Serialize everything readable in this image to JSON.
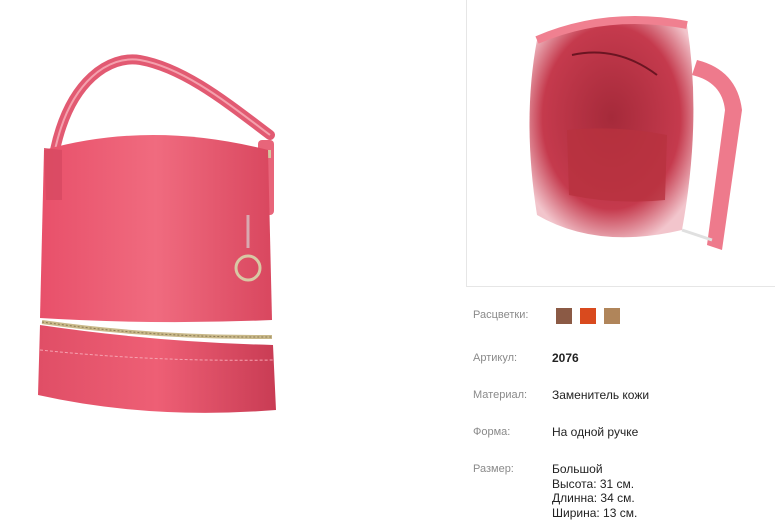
{
  "details": {
    "colors_label": "Расцветки:",
    "colors": [
      "#8b5a45",
      "#d94a1e",
      "#b0855a"
    ],
    "article_label": "Артикул:",
    "article_value": "2076",
    "material_label": "Материал:",
    "material_value": "Заменитель кожи",
    "shape_label": "Форма:",
    "shape_value": "На одной ручке",
    "size_label": "Размер:",
    "size_lines": [
      "Большой",
      "Высота: 31 см.",
      "Длинна: 34 см.",
      "Ширина: 13 см."
    ]
  },
  "images": {
    "main_icon": "pink-handbag-photo",
    "thumb_icon": "handbag-interior-photo"
  }
}
